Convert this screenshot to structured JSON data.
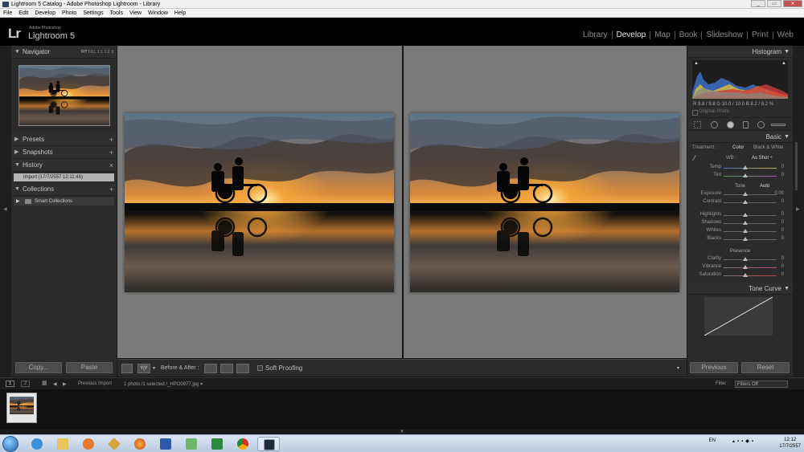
{
  "window": {
    "title": "Lightroom 5 Catalog - Adobe Photoshop Lightroom - Library",
    "controls": [
      "_",
      "▭",
      "✕"
    ]
  },
  "menu": [
    "File",
    "Edit",
    "Develop",
    "Photo",
    "Settings",
    "Tools",
    "View",
    "Window",
    "Help"
  ],
  "identity": {
    "mark": "Lr",
    "brand": "Adobe Photoshop",
    "product": "Lightroom 5"
  },
  "modules": [
    "Library",
    "Develop",
    "Map",
    "Book",
    "Slideshow",
    "Print",
    "Web"
  ],
  "active_module": "Develop",
  "left_panel": {
    "navigator": {
      "title": "Navigator",
      "zoom": [
        "FIT",
        "FILL",
        "1:1",
        "1:2",
        "⇕"
      ]
    },
    "presets": "Presets",
    "snapshots": "Snapshots",
    "history": {
      "title": "History",
      "item": "Import (17/7/2557 12:11:46)"
    },
    "collections": {
      "title": "Collections",
      "item": "Smart Collections"
    },
    "copy_label": "Copy...",
    "paste_label": "Paste"
  },
  "toolbar": {
    "view_mode": "Y|Y",
    "before_after_label": "Before & After :",
    "soft_proofing_label": "Soft Proofing"
  },
  "right_panel": {
    "histogram_title": "Histogram",
    "histogram_values": "R  9.8 / 9.8  G 10.0 / 10.0  B  8.2 / 8.2 %",
    "original_photo": "Original Photo",
    "basic_title": "Basic",
    "treatment_label": "Treatment :",
    "treatment_color": "Color",
    "treatment_bw": "Black & White",
    "wb_label": "WB :",
    "wb_value": "As Shot ÷",
    "wb_sliders": [
      {
        "label": "Temp",
        "value": "0"
      },
      {
        "label": "Tint",
        "value": "0"
      }
    ],
    "tone_label": "Tone",
    "tone_auto": "Auto",
    "tone_sliders": [
      {
        "label": "Exposure",
        "value": "0.00"
      },
      {
        "label": "Contrast",
        "value": "0"
      }
    ],
    "tone_sliders2": [
      {
        "label": "Highlights",
        "value": "0"
      },
      {
        "label": "Shadows",
        "value": "0"
      },
      {
        "label": "Whites",
        "value": "0"
      },
      {
        "label": "Blacks",
        "value": "0"
      }
    ],
    "presence_label": "Presence",
    "presence_sliders": [
      {
        "label": "Clarity",
        "value": "0"
      },
      {
        "label": "Vibrance",
        "value": "0"
      },
      {
        "label": "Saturation",
        "value": "0"
      }
    ],
    "tone_curve_title": "Tone Curve",
    "previous_label": "Previous",
    "reset_label": "Reset"
  },
  "filmstrip": {
    "view_buttons": [
      "1",
      "2"
    ],
    "source": "Previous Import",
    "selection": "1 photo /1 selected /_HPO0977.jpg ▾",
    "filter_label": "Filter :",
    "filter_value": "Filters Off"
  },
  "taskbar": {
    "lang": "EN",
    "time": "12:12",
    "date": "17/7/2557"
  }
}
